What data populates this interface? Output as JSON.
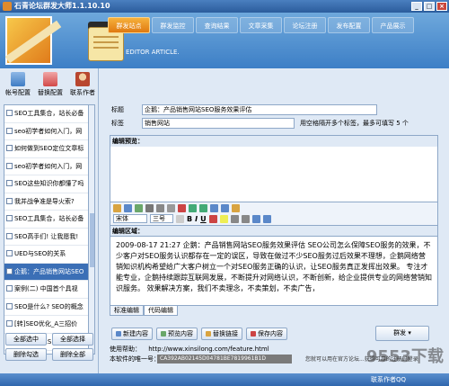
{
  "app": {
    "title": "石青论坛群发大师1.1.10.10",
    "window_buttons": [
      "_",
      "□",
      "×"
    ]
  },
  "nav": {
    "tabs": [
      "群发站点",
      "群发监控",
      "查询结果",
      "文章采集",
      "论坛注册",
      "发布配置",
      "产品展示"
    ]
  },
  "banner": {
    "editor_label": "EDITOR ARTICLE."
  },
  "left": {
    "tools": [
      "帐号配置",
      "替换配置",
      "联系作者"
    ],
    "posts": [
      "SEO工具集合，站长必备",
      "seo初学者如何入门，网",
      "如何做到SEO定位文章标",
      "seo初学者如何入门，网",
      "SEO这些知识你都懂了吗",
      "我并战争准是导火索?",
      "SEO工具集合，站长必备",
      "SEO高手们! 让我愿我!",
      "UED与SEO的关系",
      "企鹅：产品销售网站SEO",
      "案例(二) 中国首个具视",
      "SEO是什么? SEO的概念",
      "[转]SEO优化_A三招价",
      "南京推广51SEO正式发展"
    ],
    "selected_index": 9,
    "buttons": [
      "全部选中",
      "全部选择",
      "删除勾选",
      "删除全部"
    ]
  },
  "form": {
    "title_label": "标题",
    "title_value": "企鹅：产品销售网站SEO服务效果评估",
    "tags_label": "标签",
    "tags_value": "销售网站",
    "tags_hint": "用空格隔开多个标签，最多可填写 5 个",
    "preview_label": "编辑预览：",
    "font_value": "宋体",
    "size_value": "三号",
    "edit_label": "编辑区域：",
    "body_text": "2009-08-17 21:27      企鹅：产品销售网站SEO服务效果评估      SEO公司怎么保障SEO服务的效果，不少客户对SEO服务认识都存在一定的误区，导致在做过不少SEO服务过后效果不理想，企鹅网络营销知识机构希望给广大客户树立一个对SEO服务正确的认识，让SEO服务真正发挥出效果。      专注才能专业，企鹅持续跟踪互联网发展，不断提升对网络认识，不断创新，给企业提供专业的网络营销知识服务。   效果解决方案，我们不卖理念，不卖策划，不卖广告，",
    "edit_tabs": [
      "标准编辑",
      "代码编辑"
    ],
    "actions": [
      "新建内容",
      "预览内容",
      "替换链接",
      "保存内容"
    ],
    "send_label": "群发",
    "help_label": "使用帮助：",
    "help_url": "http://www.xinsilong.com/feature.html",
    "serial_label": "本软件的唯一号：",
    "serial_value": "CA392AB02145D04781BE7819961B1D",
    "pwd_hint": "您就可以用在官方论坛...获得可靠的注册码登录"
  },
  "status": {
    "text": "联系作者QQ"
  },
  "watermark": "9553下载"
}
